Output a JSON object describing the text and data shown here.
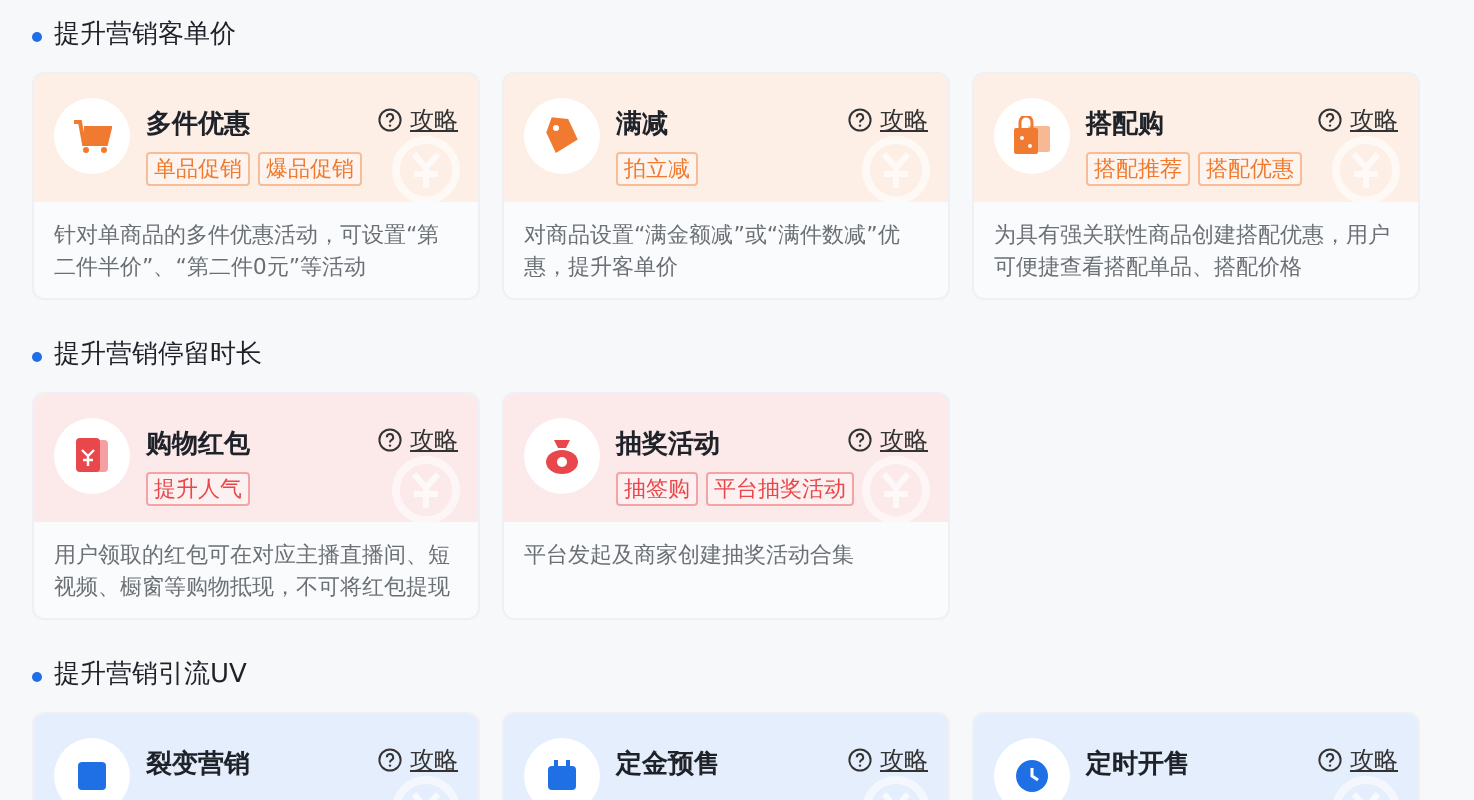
{
  "sections": [
    {
      "title": "提升营销客单价",
      "color": "#f07a2f",
      "cards": [
        {
          "title": "多件优惠",
          "help": "攻略",
          "tags": [
            "单品促销",
            "爆品促销"
          ],
          "description": "针对单商品的多件优惠活动，可设置“第二件半价”、“第二件0元”等活动"
        },
        {
          "title": "满减",
          "help": "攻略",
          "tags": [
            "拍立减"
          ],
          "description": "对商品设置“满金额减”或“满件数减”优惠，提升客单价"
        },
        {
          "title": "搭配购",
          "help": "攻略",
          "tags": [
            "搭配推荐",
            "搭配优惠"
          ],
          "description": "为具有强关联性商品创建搭配优惠，用户可便捷查看搭配单品、搭配价格"
        }
      ]
    },
    {
      "title": "提升营销停留时长",
      "color": "#e8484b",
      "cards": [
        {
          "title": "购物红包",
          "help": "攻略",
          "tags": [
            "提升人气"
          ],
          "description": "用户领取的红包可在对应主播直播间、短视频、橱窗等购物抵现，不可将红包提现"
        },
        {
          "title": "抽奖活动",
          "help": "攻略",
          "tags": [
            "抽签购",
            "平台抽奖活动"
          ],
          "description": "平台发起及商家创建抽奖活动合集"
        }
      ]
    },
    {
      "title": "提升营销引流UV",
      "color": "#1f6fe5",
      "cards": [
        {
          "title": "裂变营销",
          "help": "攻略"
        },
        {
          "title": "定金预售",
          "help": "攻略"
        },
        {
          "title": "定时开售",
          "help": "攻略"
        }
      ]
    }
  ]
}
